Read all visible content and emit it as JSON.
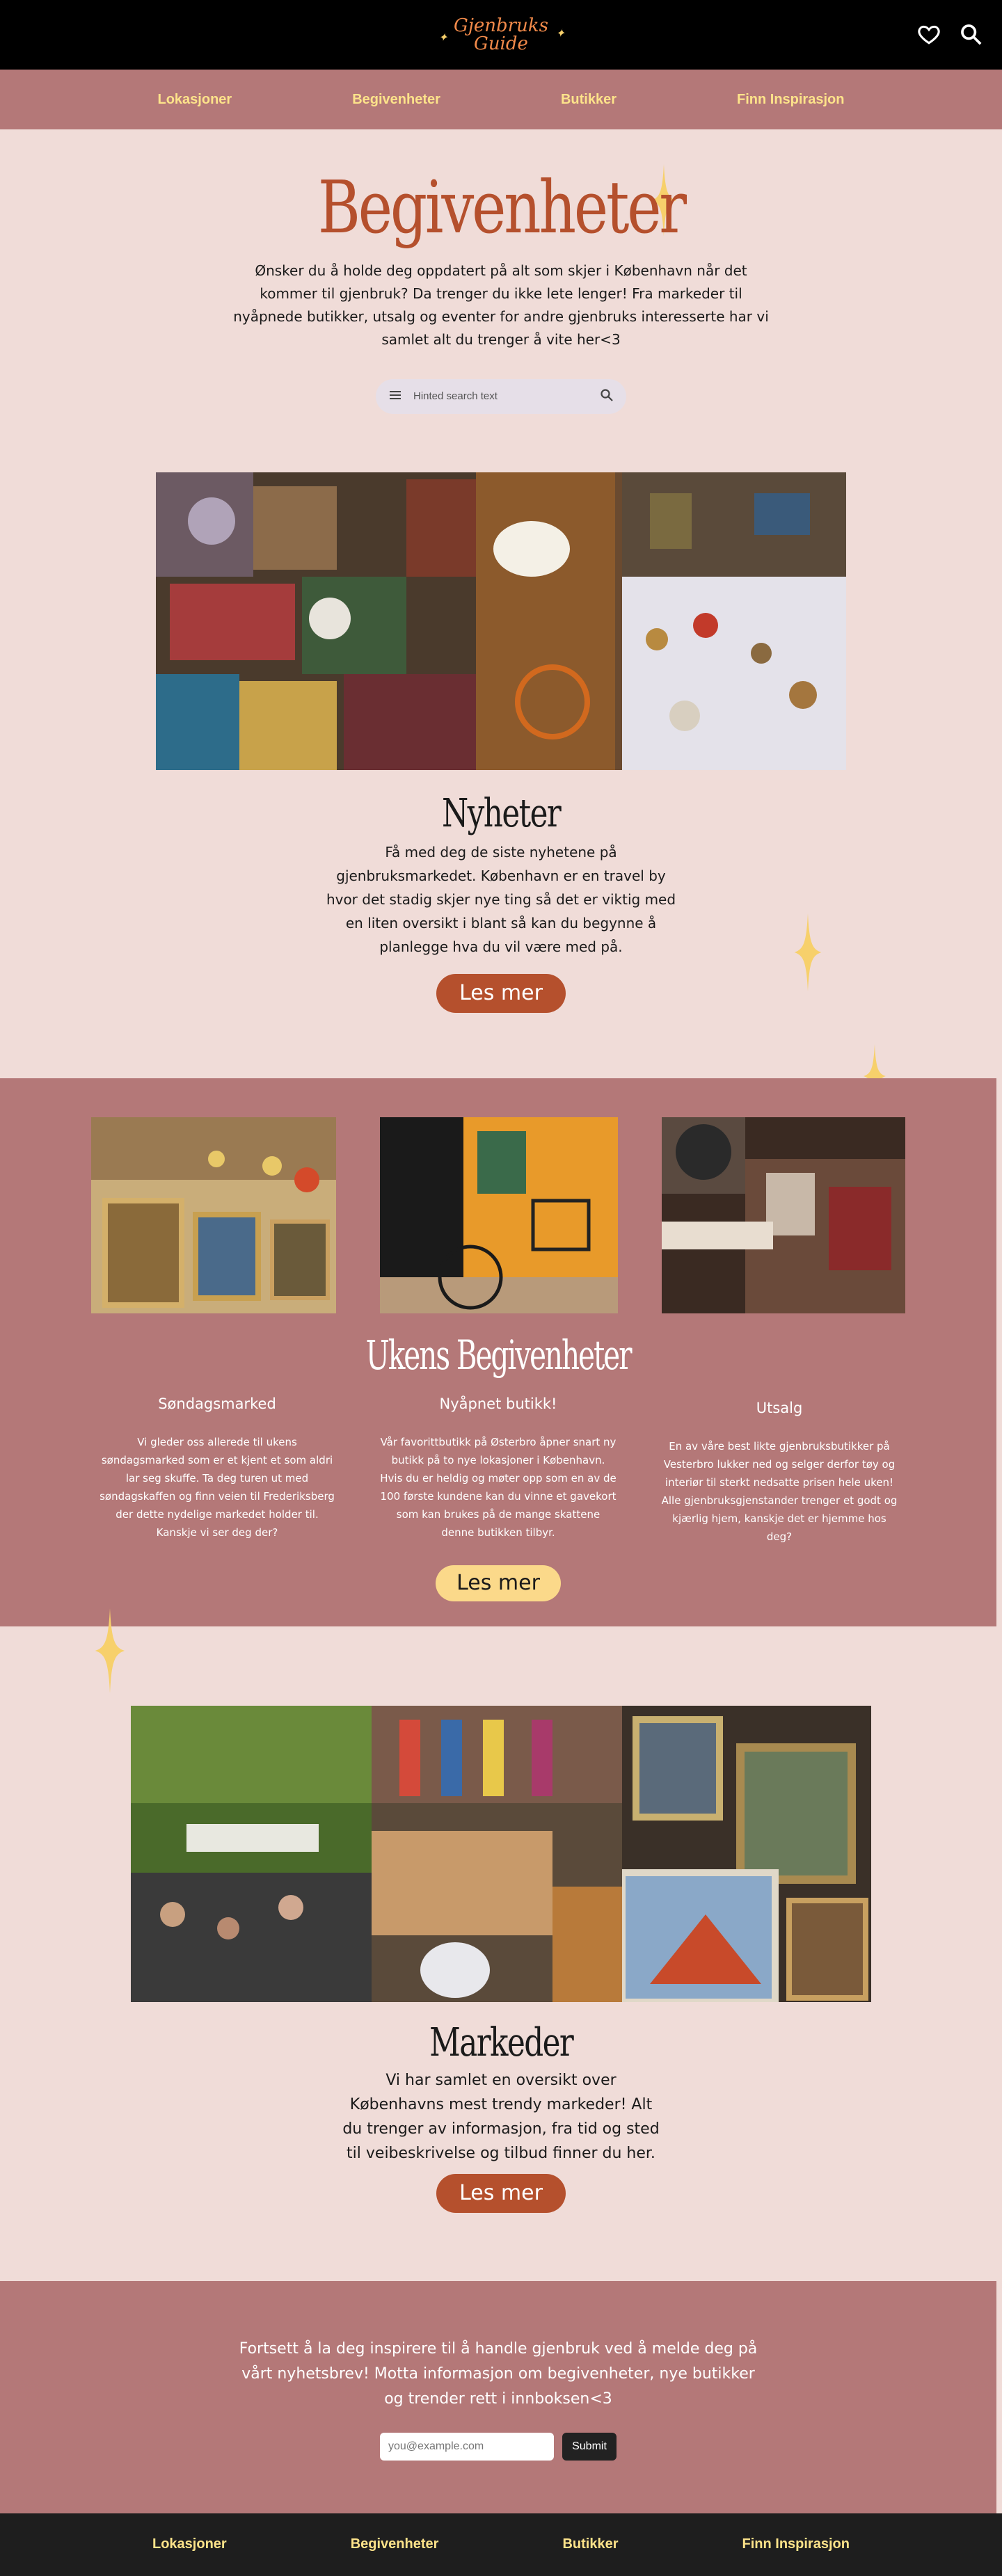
{
  "header": {
    "logo_line1": "Gjenbruks",
    "logo_line2": "Guide",
    "icons": [
      "heart-icon",
      "search-icon"
    ]
  },
  "nav": {
    "items": [
      "Lokasjoner",
      "Begivenheter",
      "Butikker",
      "Finn Inspirasjon"
    ]
  },
  "hero": {
    "title": "Begivenheter",
    "intro": "Ønsker du å holde deg oppdatert på alt som skjer i København når det kommer til gjenbruk? Da trenger du ikke lete lenger! Fra markeder til nyåpnede butikker, utsalg og eventer for andre gjenbruks interesserte har vi samlet alt du trenger å vite her<3"
  },
  "search": {
    "placeholder": "Hinted search text",
    "menu_icon": "menu-icon",
    "search_icon": "search-icon"
  },
  "news": {
    "title": "Nyheter",
    "text": "Få med deg de siste nyhetene på gjenbruksmarkedet. København er en travel by hvor det stadig skjer nye ting så det er viktig med en liten oversikt i blant så kan du begynne å planlegge hva du vil være med på.",
    "button": "Les mer"
  },
  "weekly": {
    "title": "Ukens Begivenheter",
    "button": "Les mer",
    "events": [
      {
        "title": "Søndagsmarked",
        "text": "Vi gleder oss allerede til ukens søndagsmarked som er et kjent et som aldri lar seg skuffe. Ta deg turen ut med søndagskaffen og finn veien til Frederiksberg der dette nydelige markedet holder til. Kanskje vi ser deg der?"
      },
      {
        "title": "Nyåpnet butikk!",
        "text": "Vår favorittbutikk på Østerbro åpner snart ny butikk på to nye lokasjoner i København. Hvis du er heldig og møter opp som en av de 100 første kundene kan du vinne et gavekort som kan brukes på de mange skattene denne butikken tilbyr."
      },
      {
        "title": "Utsalg",
        "text": "En av våre best likte gjenbruksbutikker på Vesterbro lukker ned og selger derfor tøy og interiør til sterkt nedsatte prisen hele uken! Alle gjenbruksgjenstander trenger et godt og kjærlig hjem, kanskje det er hjemme hos deg?"
      }
    ]
  },
  "markets": {
    "title": "Markeder",
    "text": "Vi har samlet en oversikt over Københavns mest trendy markeder! Alt du trenger av informasjon, fra tid og sted til veibeskrivelse og tilbud finner du her.",
    "button": "Les mer"
  },
  "newsletter": {
    "text": "Fortsett å la deg inspirere til å handle gjenbruk ved å melde deg på vårt nyhetsbrev! Motta informasjon om begivenheter, nye butikker og trender rett i innboksen<3",
    "email_placeholder": "you@example.com",
    "submit": "Submit"
  },
  "footer_nav": {
    "items": [
      "Lokasjoner",
      "Begivenheter",
      "Butikker",
      "Finn Inspirasjon"
    ]
  },
  "colors": {
    "background": "#f0dcd8",
    "rose": "#b47878",
    "accent_orange": "#b5502d",
    "accent_yellow": "#fde38a",
    "star": "#f7d06b"
  }
}
